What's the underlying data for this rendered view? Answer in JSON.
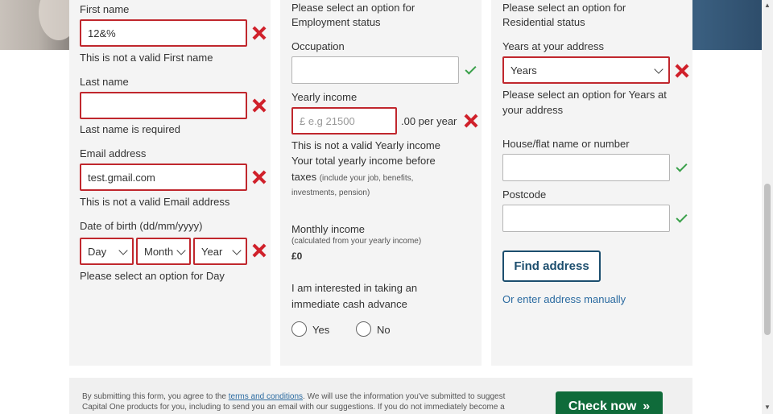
{
  "col1": {
    "first_name_label": "First name",
    "first_name_value": "12&%",
    "first_name_error": "This is not a valid First name",
    "last_name_label": "Last name",
    "last_name_value": "",
    "last_name_error": "Last name is required",
    "email_label": "Email address",
    "email_value": "test.gmail.com",
    "email_error": "This is not a valid Email address",
    "dob_label": "Date of birth (dd/mm/yyyy)",
    "dob_day": "Day",
    "dob_month": "Month",
    "dob_year": "Year",
    "dob_error": "Please select an option for Day"
  },
  "col2": {
    "employment_error_line1": "Please select an option for",
    "employment_error_line2": "Employment status",
    "occupation_label": "Occupation",
    "occupation_value": "",
    "income_label": "Yearly income",
    "income_placeholder": "£ e.g 21500",
    "income_suffix": ".00 per year",
    "income_error": "This is not a valid Yearly income",
    "income_help_line1": "Your total yearly income before",
    "income_help_taxes": "taxes",
    "income_help_small1": "(include your job, benefits,",
    "income_help_small2": "investments, pension)",
    "monthly_label": "Monthly income",
    "monthly_small": "(calculated from your yearly income)",
    "monthly_value": "£0",
    "cash_advance_line1": "I am interested in taking an",
    "cash_advance_line2": "immediate cash advance",
    "radio_yes": "Yes",
    "radio_no": "No"
  },
  "col3": {
    "residential_error_line1": "Please select an option for",
    "residential_error_line2": "Residential status",
    "years_label": "Years at your address",
    "years_value": "Years",
    "years_error_line1": "Please select an option for Years at",
    "years_error_line2": "your address",
    "house_label": "House/flat name or number",
    "house_value": "",
    "postcode_label": "Postcode",
    "postcode_value": "",
    "find_address": "Find address",
    "enter_manually": "Or enter address manually"
  },
  "footer": {
    "text_before": "By submitting this form, you agree to the ",
    "terms_link": "terms and conditions",
    "text_after": ". We will use the information you've submitted to suggest Capital One products for you, including to send you an email with our suggestions. If you do not immediately become a",
    "check_now": "Check now",
    "check_now_icon": "»"
  },
  "colors": {
    "error_red": "#c0272d",
    "valid_green": "#3aa04a",
    "brand_navy": "#1c4e6e",
    "cta_green": "#0f6b3a"
  }
}
